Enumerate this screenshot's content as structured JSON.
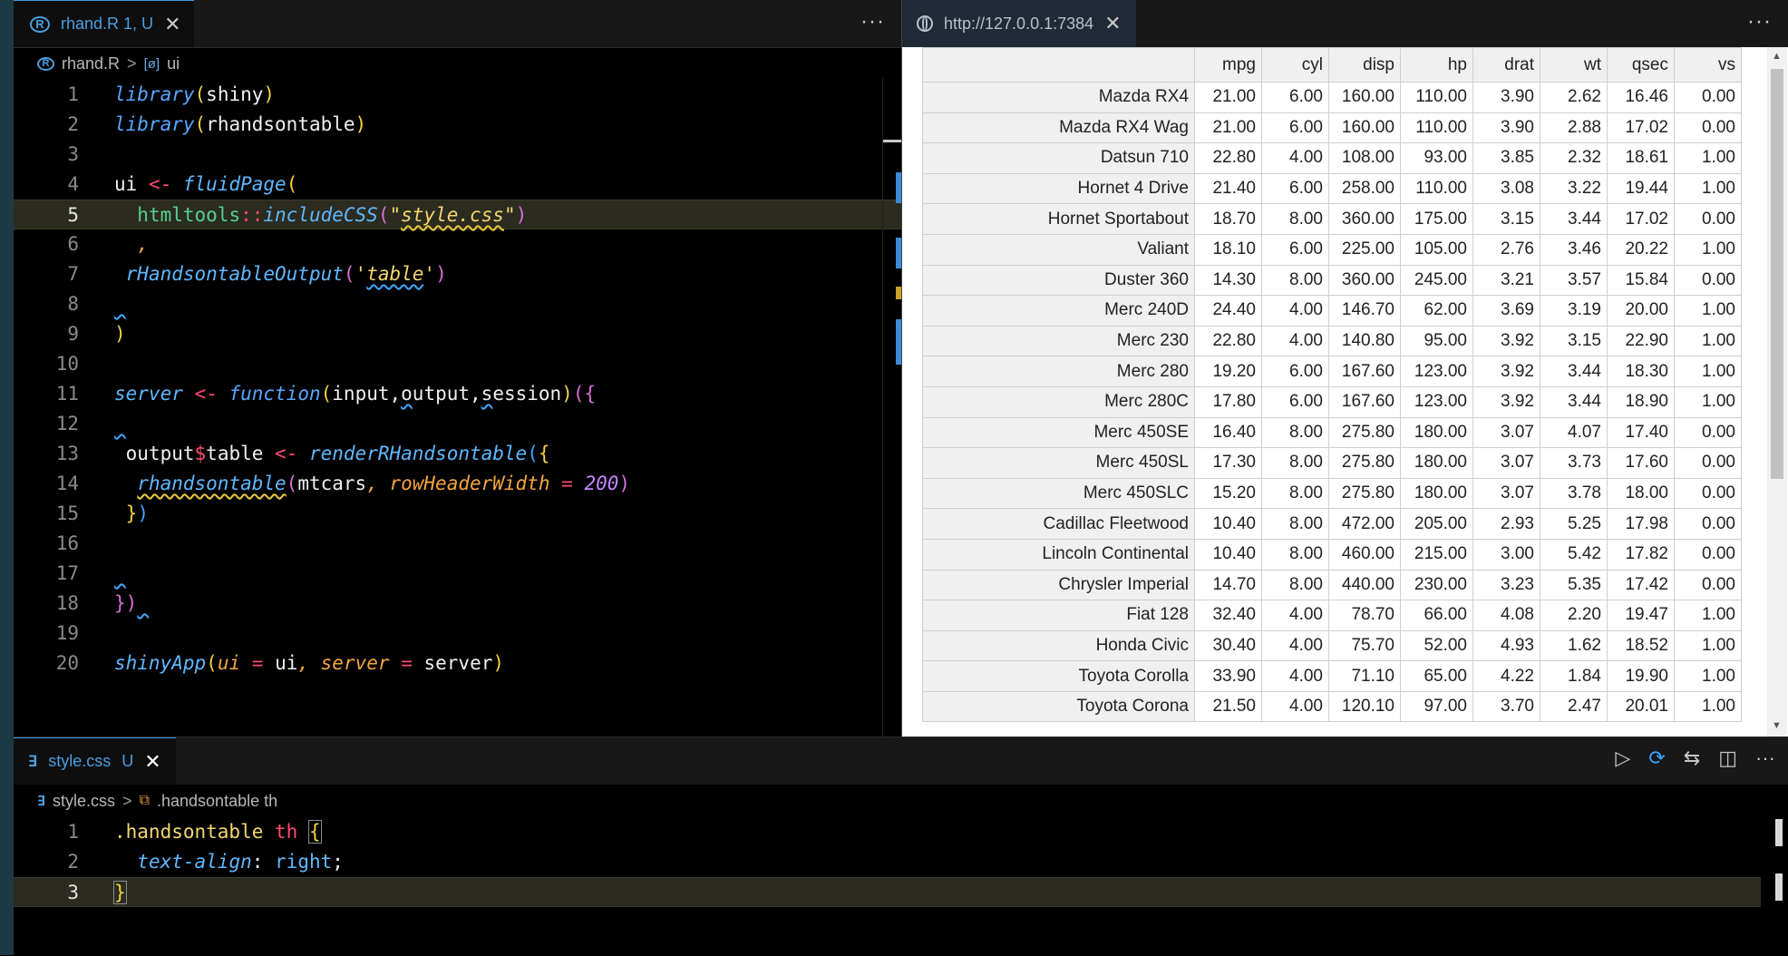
{
  "top_editor": {
    "tab": {
      "label": "rhand.R 1, U",
      "close": "✕"
    },
    "more": "···",
    "breadcrumb": {
      "file": "rhand.R",
      "sep": ">",
      "symbol_icon": "[ø]",
      "symbol": "ui"
    },
    "line_numbers": [
      "1",
      "2",
      "3",
      "4",
      "5",
      "6",
      "7",
      "8",
      "9",
      "10",
      "11",
      "12",
      "13",
      "14",
      "15",
      "16",
      "17",
      "18",
      "19",
      "20"
    ]
  },
  "browser": {
    "tab": {
      "url": "http://127.0.0.1:7384",
      "close": "✕"
    },
    "more": "···",
    "table": {
      "columns": [
        "mpg",
        "cyl",
        "disp",
        "hp",
        "drat",
        "wt",
        "qsec",
        "vs"
      ],
      "rows": [
        {
          "name": "Mazda RX4",
          "values": [
            "21.00",
            "6.00",
            "160.00",
            "110.00",
            "3.90",
            "2.62",
            "16.46",
            "0.00"
          ]
        },
        {
          "name": "Mazda RX4 Wag",
          "values": [
            "21.00",
            "6.00",
            "160.00",
            "110.00",
            "3.90",
            "2.88",
            "17.02",
            "0.00"
          ]
        },
        {
          "name": "Datsun 710",
          "values": [
            "22.80",
            "4.00",
            "108.00",
            "93.00",
            "3.85",
            "2.32",
            "18.61",
            "1.00"
          ]
        },
        {
          "name": "Hornet 4 Drive",
          "values": [
            "21.40",
            "6.00",
            "258.00",
            "110.00",
            "3.08",
            "3.22",
            "19.44",
            "1.00"
          ]
        },
        {
          "name": "Hornet Sportabout",
          "values": [
            "18.70",
            "8.00",
            "360.00",
            "175.00",
            "3.15",
            "3.44",
            "17.02",
            "0.00"
          ]
        },
        {
          "name": "Valiant",
          "values": [
            "18.10",
            "6.00",
            "225.00",
            "105.00",
            "2.76",
            "3.46",
            "20.22",
            "1.00"
          ]
        },
        {
          "name": "Duster 360",
          "values": [
            "14.30",
            "8.00",
            "360.00",
            "245.00",
            "3.21",
            "3.57",
            "15.84",
            "0.00"
          ]
        },
        {
          "name": "Merc 240D",
          "values": [
            "24.40",
            "4.00",
            "146.70",
            "62.00",
            "3.69",
            "3.19",
            "20.00",
            "1.00"
          ]
        },
        {
          "name": "Merc 230",
          "values": [
            "22.80",
            "4.00",
            "140.80",
            "95.00",
            "3.92",
            "3.15",
            "22.90",
            "1.00"
          ]
        },
        {
          "name": "Merc 280",
          "values": [
            "19.20",
            "6.00",
            "167.60",
            "123.00",
            "3.92",
            "3.44",
            "18.30",
            "1.00"
          ]
        },
        {
          "name": "Merc 280C",
          "values": [
            "17.80",
            "6.00",
            "167.60",
            "123.00",
            "3.92",
            "3.44",
            "18.90",
            "1.00"
          ]
        },
        {
          "name": "Merc 450SE",
          "values": [
            "16.40",
            "8.00",
            "275.80",
            "180.00",
            "3.07",
            "4.07",
            "17.40",
            "0.00"
          ]
        },
        {
          "name": "Merc 450SL",
          "values": [
            "17.30",
            "8.00",
            "275.80",
            "180.00",
            "3.07",
            "3.73",
            "17.60",
            "0.00"
          ]
        },
        {
          "name": "Merc 450SLC",
          "values": [
            "15.20",
            "8.00",
            "275.80",
            "180.00",
            "3.07",
            "3.78",
            "18.00",
            "0.00"
          ]
        },
        {
          "name": "Cadillac Fleetwood",
          "values": [
            "10.40",
            "8.00",
            "472.00",
            "205.00",
            "2.93",
            "5.25",
            "17.98",
            "0.00"
          ]
        },
        {
          "name": "Lincoln Continental",
          "values": [
            "10.40",
            "8.00",
            "460.00",
            "215.00",
            "3.00",
            "5.42",
            "17.82",
            "0.00"
          ]
        },
        {
          "name": "Chrysler Imperial",
          "values": [
            "14.70",
            "8.00",
            "440.00",
            "230.00",
            "3.23",
            "5.35",
            "17.42",
            "0.00"
          ]
        },
        {
          "name": "Fiat 128",
          "values": [
            "32.40",
            "4.00",
            "78.70",
            "66.00",
            "4.08",
            "2.20",
            "19.47",
            "1.00"
          ]
        },
        {
          "name": "Honda Civic",
          "values": [
            "30.40",
            "4.00",
            "75.70",
            "52.00",
            "4.93",
            "1.62",
            "18.52",
            "1.00"
          ]
        },
        {
          "name": "Toyota Corolla",
          "values": [
            "33.90",
            "4.00",
            "71.10",
            "65.00",
            "4.22",
            "1.84",
            "19.90",
            "1.00"
          ]
        },
        {
          "name": "Toyota Corona",
          "values": [
            "21.50",
            "4.00",
            "120.10",
            "97.00",
            "3.70",
            "2.47",
            "20.01",
            "1.00"
          ]
        }
      ]
    }
  },
  "bottom_editor": {
    "tab": {
      "icon": "∃",
      "label": "style.css",
      "status": "U",
      "close": "✕"
    },
    "breadcrumb": {
      "file": "style.css",
      "sep": ">",
      "symbol": ".handsontable th"
    },
    "toolbar": {
      "run": "▷",
      "sync": "⟳",
      "compare": "⇆",
      "split": "◫",
      "more": "···"
    },
    "line_numbers": [
      "1",
      "2",
      "3"
    ]
  },
  "colors": {
    "accent": "#3f97d9",
    "background": "#000000",
    "line_highlight": "#2b2b20"
  }
}
